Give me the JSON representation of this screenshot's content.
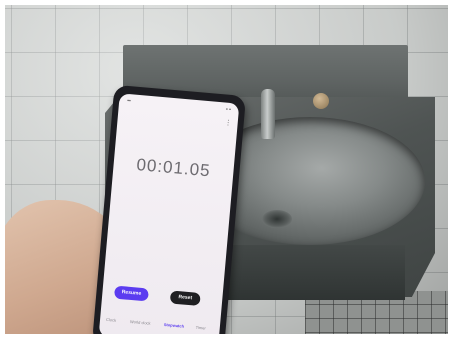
{
  "photo": {
    "scene": "public-restroom",
    "colors": {
      "tile": "#d3d6d4",
      "steel": "#5f6463",
      "accent": "#5b3cf0"
    }
  },
  "phone": {
    "app": {
      "timer": "00:01.05",
      "buttons": {
        "resume": "Resume",
        "reset": "Reset"
      },
      "tabs": [
        "Clock",
        "World clock",
        "Stopwatch",
        "Timer"
      ],
      "active_tab": "Stopwatch"
    }
  }
}
